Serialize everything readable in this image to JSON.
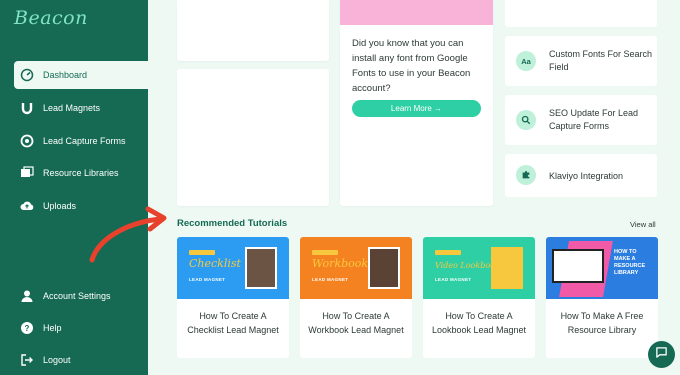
{
  "app": {
    "logo": "Beacon"
  },
  "sidebar": {
    "items": [
      {
        "label": "Dashboard",
        "icon": "dashboard-icon",
        "active": true
      },
      {
        "label": "Lead Magnets",
        "icon": "magnet-icon"
      },
      {
        "label": "Lead Capture Forms",
        "icon": "form-icon"
      },
      {
        "label": "Resource Libraries",
        "icon": "library-icon"
      },
      {
        "label": "Uploads",
        "icon": "upload-icon"
      }
    ],
    "bottom_items": [
      {
        "label": "Account Settings",
        "icon": "user-icon"
      },
      {
        "label": "Help",
        "icon": "help-icon"
      },
      {
        "label": "Logout",
        "icon": "logout-icon"
      }
    ]
  },
  "tip": {
    "text": "Did you know that you can install any font from Google Fonts to use in your Beacon account?",
    "button": "Learn More →"
  },
  "updates": [
    {
      "icon_text": "Aa",
      "label": "Custom Fonts For Search Field"
    },
    {
      "icon_text": "",
      "icon": "search-icon",
      "label": "SEO Update For Lead Capture Forms"
    },
    {
      "icon_text": "",
      "icon": "puzzle-icon",
      "label": "Klaviyo Integration"
    }
  ],
  "tutorials": {
    "title": "Recommended Tutorials",
    "view_all": "View all",
    "items": [
      {
        "title": "How To Create A Checklist Lead Magnet",
        "thumb_script": "Checklist",
        "thumb_sub": "LEAD MAGNET",
        "color": "#2b9cf2"
      },
      {
        "title": "How To Create A Workbook Lead Magnet",
        "thumb_script": "Workbook",
        "thumb_sub": "LEAD MAGNET",
        "color": "#f58220"
      },
      {
        "title": "How To Create A Lookbook Lead Magnet",
        "thumb_script": "Video Lookbook",
        "thumb_sub": "LEAD MAGNET",
        "color": "#2fcfa5"
      },
      {
        "title": "How To Make A Free Resource Library",
        "thumb_script": "HOW TO MAKE A RESOURCE LIBRARY",
        "thumb_sub": "",
        "color": "#2b7de0"
      }
    ]
  },
  "colors": {
    "sidebar": "#166a54",
    "accent": "#2fcfa5",
    "background": "#eef9f4",
    "arrow": "#e8412c"
  }
}
